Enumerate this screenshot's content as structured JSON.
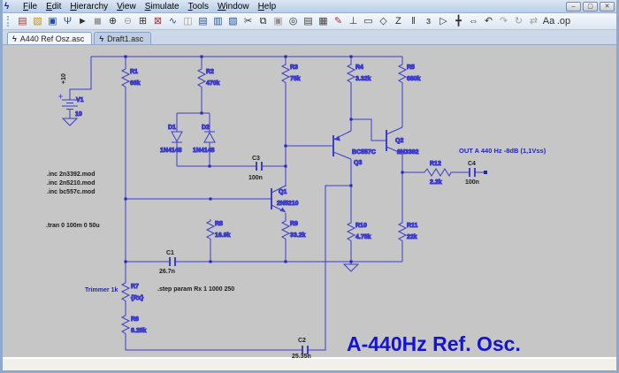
{
  "menu": {
    "items": [
      "File",
      "Edit",
      "Hierarchy",
      "View",
      "Simulate",
      "Tools",
      "Window",
      "Help"
    ]
  },
  "window_controls": {
    "minimize": "–",
    "restore": "▢",
    "close": "✕"
  },
  "app_icon_glyph": "ϟ",
  "toolbar": {
    "icons": [
      {
        "name": "new-schematic-icon",
        "glyph": "▤",
        "color": "#b03030"
      },
      {
        "name": "open-icon",
        "glyph": "▧",
        "color": "#c09020"
      },
      {
        "name": "save-icon",
        "glyph": "▣",
        "color": "#2050a0"
      },
      {
        "name": "control-panel-icon",
        "glyph": "Ψ",
        "color": "#2050a0"
      },
      {
        "name": "run-icon",
        "glyph": "►",
        "color": "#303030"
      },
      {
        "name": "halt-icon",
        "glyph": "◼",
        "color": "#a0a0a0"
      },
      {
        "name": "zoom-in-icon",
        "glyph": "⊕",
        "color": "#303030"
      },
      {
        "name": "zoom-out-icon",
        "glyph": "⊖",
        "color": "#a0a0a0"
      },
      {
        "name": "zoom-area-icon",
        "glyph": "⊞",
        "color": "#303030"
      },
      {
        "name": "zoom-full-icon",
        "glyph": "⊠",
        "color": "#b03030"
      },
      {
        "name": "waveform-icon",
        "glyph": "∿",
        "color": "#2050a0"
      },
      {
        "name": "settings-icon",
        "glyph": "◫",
        "color": "#a0a0a0"
      },
      {
        "name": "tile-horizontal-icon",
        "glyph": "▤",
        "color": "#2050a0"
      },
      {
        "name": "tile-vertical-icon",
        "glyph": "▥",
        "color": "#2050a0"
      },
      {
        "name": "cascade-icon",
        "glyph": "▧",
        "color": "#2050a0"
      },
      {
        "name": "cut-icon",
        "glyph": "✂",
        "color": "#303030"
      },
      {
        "name": "copy-icon",
        "glyph": "⧉",
        "color": "#303030"
      },
      {
        "name": "paste-icon",
        "glyph": "▣",
        "color": "#909090"
      },
      {
        "name": "find-icon",
        "glyph": "◎",
        "color": "#303030"
      },
      {
        "name": "print-preview-icon",
        "glyph": "▤",
        "color": "#404040"
      },
      {
        "name": "print-icon",
        "glyph": "▦",
        "color": "#404040"
      },
      {
        "name": "wire-icon",
        "glyph": "✎",
        "color": "#b03030"
      },
      {
        "name": "ground-icon",
        "glyph": "⊥",
        "color": "#303030"
      },
      {
        "name": "label-icon",
        "glyph": "▭",
        "color": "#303030"
      },
      {
        "name": "port-icon",
        "glyph": "◇",
        "color": "#303030"
      },
      {
        "name": "resistor-icon",
        "glyph": "Z",
        "color": "#303030"
      },
      {
        "name": "capacitor-icon",
        "glyph": "‖",
        "color": "#303030"
      },
      {
        "name": "inductor-icon",
        "glyph": "ɜ",
        "color": "#303030"
      },
      {
        "name": "diode-icon",
        "glyph": "▷",
        "color": "#303030"
      },
      {
        "name": "move-icon",
        "glyph": "╋",
        "color": "#303030"
      },
      {
        "name": "drag-icon",
        "glyph": "⇔",
        "color": "#303030"
      },
      {
        "name": "undo-icon",
        "glyph": "↶",
        "color": "#303030"
      },
      {
        "name": "redo-icon",
        "glyph": "↷",
        "color": "#a0a0a0"
      },
      {
        "name": "rotate-icon",
        "glyph": "↻",
        "color": "#a0a0a0"
      },
      {
        "name": "mirror-icon",
        "glyph": "⇄",
        "color": "#a0a0a0"
      },
      {
        "name": "text-icon",
        "glyph": "Aa",
        "color": "#303030"
      },
      {
        "name": "spice-directive-icon",
        "glyph": ".op",
        "color": "#303030"
      }
    ]
  },
  "tabs": [
    {
      "label": "A440 Ref Osz.asc",
      "state": "active"
    },
    {
      "label": "Draft1.asc",
      "state": "inactive"
    }
  ],
  "colors": {
    "wire": "#3c3ccd",
    "node": "#2424bb",
    "canvas": "#c6c6c6"
  },
  "schematic": {
    "supply_label": "+10",
    "components": {
      "V1": {
        "name": "V1",
        "value": "10"
      },
      "R1": {
        "name": "R1",
        "value": "68k"
      },
      "R2": {
        "name": "R2",
        "value": "470k"
      },
      "R3": {
        "name": "R3",
        "value": "75k"
      },
      "R4": {
        "name": "R4",
        "value": "3.32k"
      },
      "R5": {
        "name": "R5",
        "value": "680k"
      },
      "R6": {
        "name": "R6",
        "value": "8.25k"
      },
      "R7": {
        "name": "R7",
        "value": "{Rx}"
      },
      "R8": {
        "name": "R8",
        "value": "16.9k"
      },
      "R9": {
        "name": "R9",
        "value": "33.2k"
      },
      "R10": {
        "name": "R10",
        "value": "4.75k"
      },
      "R11": {
        "name": "R11",
        "value": "22k"
      },
      "R12": {
        "name": "R12",
        "value": "2.2k"
      },
      "C1": {
        "name": "C1",
        "value": "26.7n"
      },
      "C2": {
        "name": "C2",
        "value": "25.35n"
      },
      "C3": {
        "name": "C3",
        "value": "100n"
      },
      "C4": {
        "name": "C4",
        "value": "100n"
      },
      "D1": {
        "name": "D1",
        "value": "1N4148"
      },
      "D2": {
        "name": "D2",
        "value": "1N4148"
      },
      "Q1": {
        "name": "Q1",
        "value": "2N5210"
      },
      "Q2": {
        "name": "Q2",
        "value": "2N3392"
      },
      "Q3": {
        "name": "Q3",
        "value": "BC557C"
      }
    },
    "directives": {
      "inc1": ".inc 2n3392.mod",
      "inc2": ".inc 2n5210.mod",
      "inc3": ".inc bc557c.mod",
      "tran": ".tran 0 100m 0 50u",
      "step": ".step param Rx 1 1000 250"
    },
    "annotations": {
      "trimmer": "Trimmer 1k",
      "output": "OUT A 440 Hz -8dB (1,1Vss)",
      "title": "A-440Hz Ref. Osc."
    }
  }
}
